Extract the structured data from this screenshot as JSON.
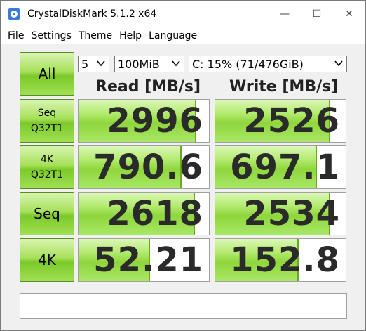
{
  "window": {
    "title": "CrystalDiskMark 5.1.2 x64",
    "minimize_glyph": "—",
    "maximize_glyph": "☐",
    "close_glyph": "✕"
  },
  "menu": {
    "items": [
      {
        "label": "File"
      },
      {
        "label": "Settings"
      },
      {
        "label": "Theme"
      },
      {
        "label": "Help"
      },
      {
        "label": "Language"
      }
    ]
  },
  "controls": {
    "all_label": "All",
    "test_count": "5",
    "test_size": "100MiB",
    "drive": "C: 15% (71/476GiB)"
  },
  "headers": {
    "read": "Read [MB/s]",
    "write": "Write [MB/s]"
  },
  "tests": [
    {
      "label_line1": "Seq",
      "label_line2": "Q32T1",
      "read": "2996",
      "write": "2526",
      "read_fill": 0.89,
      "write_fill": 0.87
    },
    {
      "label_line1": "4K",
      "label_line2": "Q32T1",
      "read": "790.6",
      "write": "697.1",
      "read_fill": 0.78,
      "write_fill": 0.77
    },
    {
      "label_line1": "Seq",
      "label_line2": "",
      "read": "2618",
      "write": "2534",
      "read_fill": 0.88,
      "write_fill": 0.87
    },
    {
      "label_line1": "4K",
      "label_line2": "",
      "read": "52.21",
      "write": "152.8",
      "read_fill": 0.54,
      "write_fill": 0.63
    }
  ],
  "comment": "",
  "colors": {
    "accent_green": "#8fd63c",
    "border_green": "#6aaa22"
  }
}
